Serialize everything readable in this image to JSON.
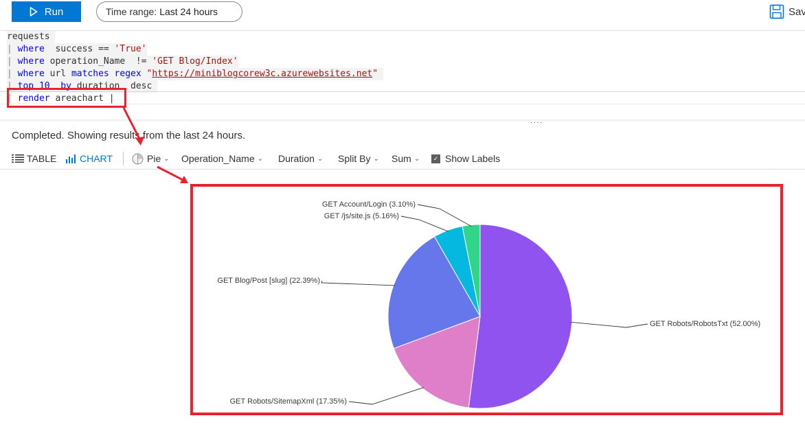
{
  "toolbar": {
    "run_label": "Run",
    "time_range_label": "Time range:",
    "time_range_value": "Last 24 hours",
    "save_label": "Sav"
  },
  "editor": {
    "lines": [
      {
        "segments": [
          {
            "t": "requests",
            "c": ""
          },
          {
            "t": " ",
            "c": ""
          }
        ]
      },
      {
        "segments": [
          {
            "t": "| ",
            "c": "pipe"
          },
          {
            "t": "where",
            "c": "kw"
          },
          {
            "t": "  success == ",
            "c": ""
          },
          {
            "t": "'True'",
            "c": "str"
          }
        ]
      },
      {
        "segments": [
          {
            "t": "| ",
            "c": "pipe"
          },
          {
            "t": "where",
            "c": "kw"
          },
          {
            "t": " operation_Name  != ",
            "c": ""
          },
          {
            "t": "'GET Blog/Index'",
            "c": "str"
          }
        ]
      },
      {
        "segments": [
          {
            "t": "| ",
            "c": "pipe"
          },
          {
            "t": "where",
            "c": "kw"
          },
          {
            "t": " url ",
            "c": ""
          },
          {
            "t": "matches regex",
            "c": "kw"
          },
          {
            "t": " ",
            "c": ""
          },
          {
            "t": "\"",
            "c": "str"
          },
          {
            "t": "https://miniblogcorew3c.azurewebsites.net",
            "c": "url"
          },
          {
            "t": "\"",
            "c": "str"
          },
          {
            "t": " ",
            "c": ""
          }
        ]
      },
      {
        "segments": [
          {
            "t": "| ",
            "c": "pipe"
          },
          {
            "t": "top",
            "c": "kw"
          },
          {
            "t": " ",
            "c": ""
          },
          {
            "t": "10",
            "c": "kw"
          },
          {
            "t": "  ",
            "c": ""
          },
          {
            "t": "by",
            "c": "kw"
          },
          {
            "t": " duration  desc ",
            "c": ""
          }
        ]
      },
      {
        "segments": [
          {
            "t": "| ",
            "c": "pipe"
          },
          {
            "t": "render",
            "c": "kw"
          },
          {
            "t": " areachart ",
            "c": ""
          },
          {
            "t": "|",
            "c": ""
          }
        ]
      }
    ],
    "splitter_dots": "...."
  },
  "status": "Completed. Showing results from the last 24 hours.",
  "results_toolbar": {
    "table_label": "TABLE",
    "chart_label": "CHART",
    "chart_type": "Pie",
    "x_column": "Operation_Name",
    "y_column": "Duration",
    "split_by": "Split By",
    "aggregation": "Sum",
    "show_labels": "Show Labels"
  },
  "colors": {
    "accent": "#0078d4",
    "annotation_red": "#e8222e"
  },
  "chart_data": {
    "type": "pie",
    "slices": [
      {
        "label": "GET Robots/RobotsTxt (52.00%)",
        "name": "GET Robots/RobotsTxt",
        "value": 52.0,
        "color": "#9153f0"
      },
      {
        "label": "GET Robots/SitemapXml (17.35%)",
        "name": "GET Robots/SitemapXml",
        "value": 17.35,
        "color": "#e07fc9"
      },
      {
        "label": "GET Blog/Post [slug] (22.39%)",
        "name": "GET Blog/Post [slug]",
        "value": 22.39,
        "color": "#6577ea"
      },
      {
        "label": "GET /js/site.js (5.16%)",
        "name": "GET /js/site.js",
        "value": 5.16,
        "color": "#05b8e0"
      },
      {
        "label": "GET Account/Login (3.10%)",
        "name": "GET Account/Login",
        "value": 3.1,
        "color": "#30d58a"
      }
    ]
  }
}
